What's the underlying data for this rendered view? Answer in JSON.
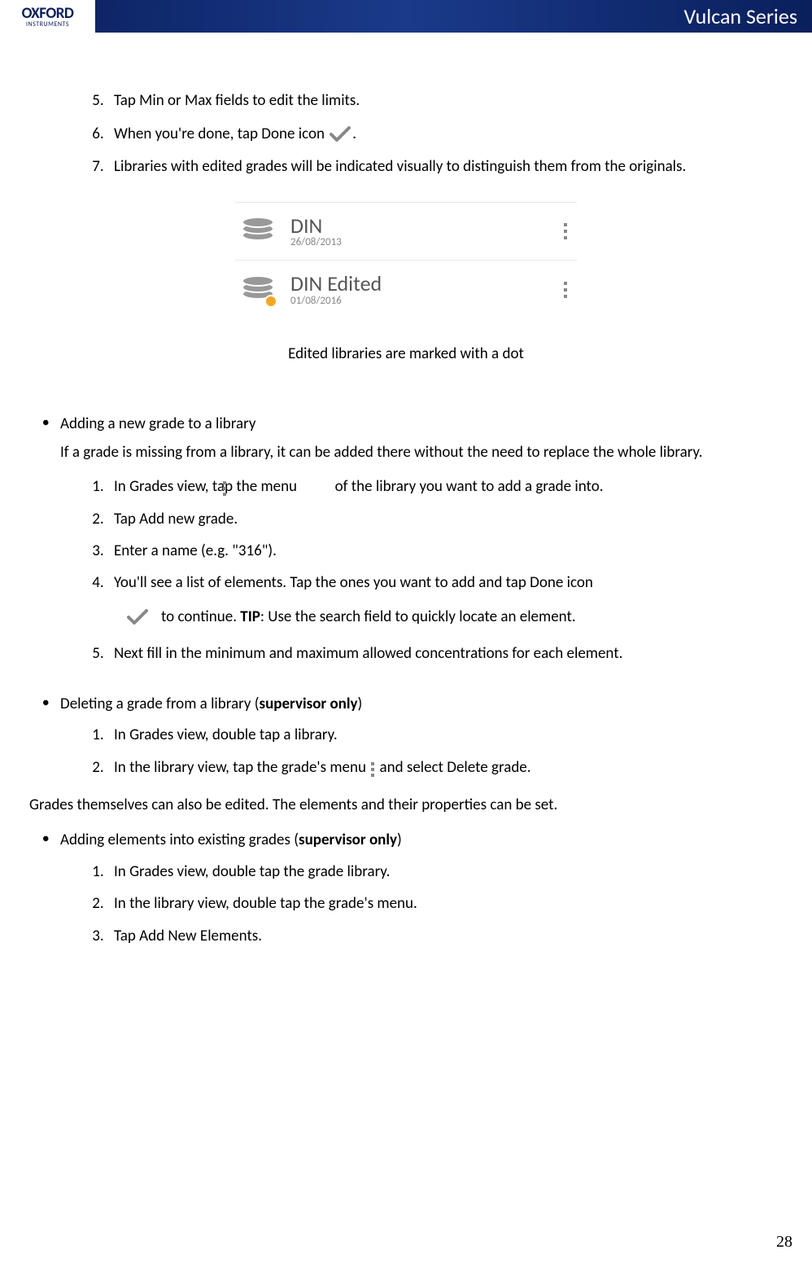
{
  "header": {
    "logo_main": "OXFORD",
    "logo_sub": "INSTRUMENTS",
    "title": "Vulcan Series"
  },
  "steps_top": {
    "s5": "Tap Min or Max fields to edit the limits.",
    "s6_a": "When you're done, tap Done icon",
    "s6_b": ".",
    "s7": "Libraries with edited grades will be indicated visually to distinguish them from the originals."
  },
  "figure": {
    "row1_name": "DIN",
    "row1_date": "26/08/2013",
    "row2_name": "DIN Edited",
    "row2_date": "01/08/2016",
    "caption": "Edited libraries are marked with a dot"
  },
  "add_grade": {
    "title": "Adding a new grade to a library",
    "intro": "If a grade is missing from a library, it can be added there without the need to replace the whole library.",
    "s1_a": "In Grades view, tap the menu",
    "s1_b": "of the library you want to add a grade into.",
    "s2": "Tap Add new grade.",
    "s3": "Enter a name (e.g. \"316\").",
    "s4": "You'll see a list of elements. Tap the ones you want to add and tap Done icon",
    "tip_a": "to continue. ",
    "tip_label": "TIP",
    "tip_b": ": Use the search field to quickly locate an element.",
    "s5": "Next fill in the minimum and maximum allowed concentrations for each element."
  },
  "delete_grade": {
    "title_a": "Deleting a grade from a library (",
    "title_bold": "supervisor only",
    "title_b": ")",
    "s1": "In Grades view, double tap a library.",
    "s2_a": "In the library view, tap the grade's menu",
    "s2_b": "and select Delete grade."
  },
  "edit_intro": "Grades themselves can also be edited. The elements and their properties can be set.",
  "add_elements": {
    "title_a": "Adding elements into existing grades (",
    "title_bold": "supervisor only",
    "title_b": ")",
    "s1": "In Grades view, double tap the grade library.",
    "s2": "In the library view, double tap the grade's menu.",
    "s3": "Tap Add New Elements."
  },
  "page_number": "28"
}
